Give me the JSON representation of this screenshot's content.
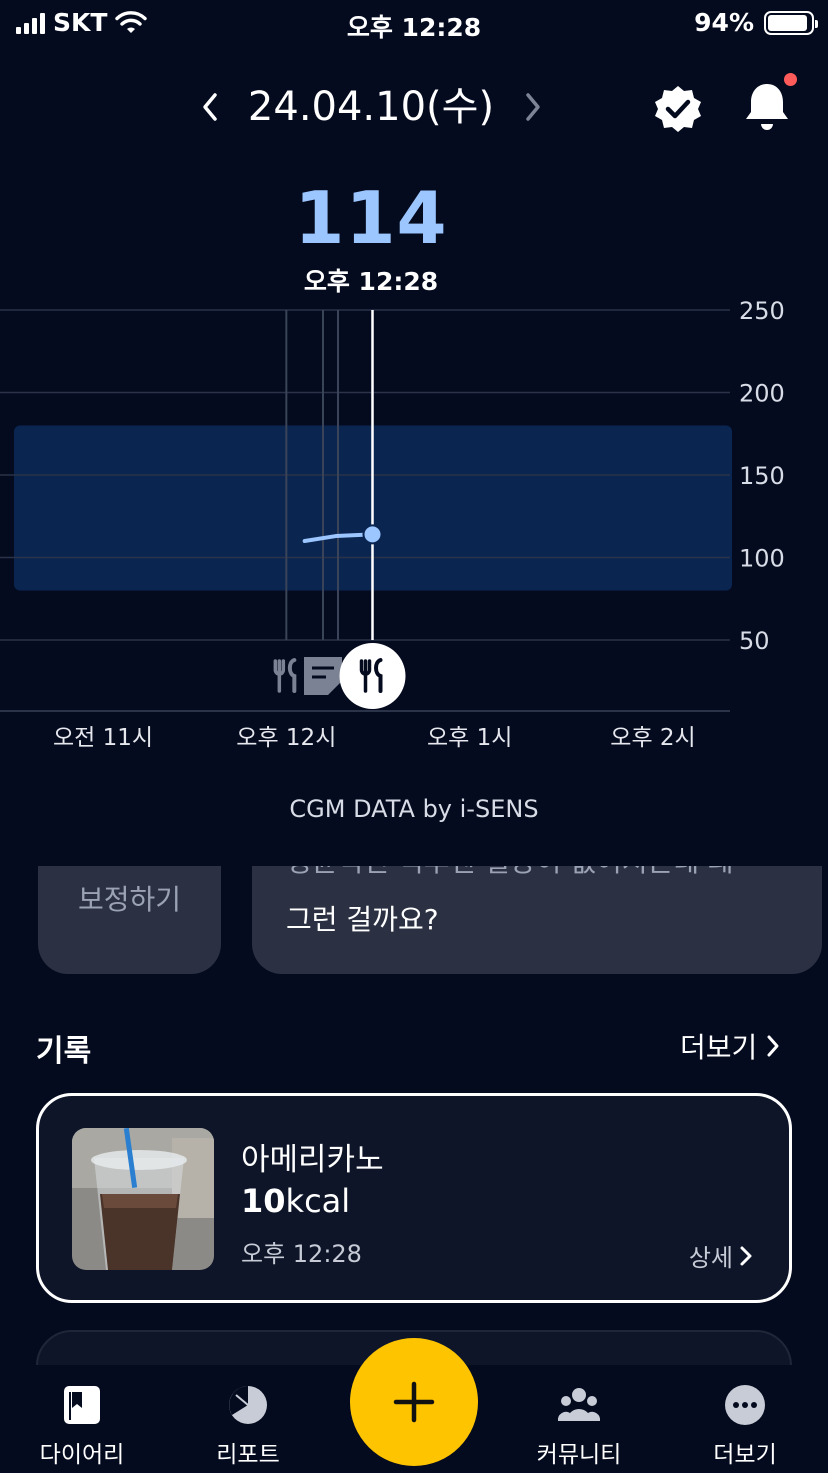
{
  "status_bar": {
    "carrier": "SKT",
    "time": "오후 12:28",
    "battery": "94%",
    "battery_level": 0.94
  },
  "header": {
    "date": "24.04.10(수)"
  },
  "glucose": {
    "value": "114",
    "time": "오후 12:28"
  },
  "chart_data": {
    "type": "line",
    "title": "",
    "y_ticks": [
      "250",
      "200",
      "150",
      "100",
      "50"
    ],
    "ylim": [
      50,
      250
    ],
    "target_range": [
      80,
      180
    ],
    "x_ticks": [
      "오전 11시",
      "오후 12시",
      "오후 1시",
      "오후 2시"
    ],
    "series": [
      {
        "values": [
          [
            12.1,
            110
          ],
          [
            12.27,
            113
          ],
          [
            12.47,
            114
          ]
        ]
      }
    ],
    "event_markers": [
      {
        "icon": "meal-icon",
        "time": 12.0
      },
      {
        "icon": "note-icon",
        "time": 12.2
      },
      {
        "icon": "meal-icon",
        "time": 12.47,
        "selected": true
      }
    ],
    "credit": "CGM DATA by i-SENS"
  },
  "cards": {
    "calibrate": "보정하기",
    "message_partial": "평균적인 식후엔 혈당이 없어지는데 왜",
    "message": "그런 걸까요?"
  },
  "records": {
    "title": "기록",
    "more": "더보기",
    "items": [
      {
        "name": "아메리카노",
        "kcal_value": "10",
        "kcal_unit": "kcal",
        "time": "오후 12:28",
        "detail": "상세"
      }
    ]
  },
  "nav": {
    "items": [
      {
        "label": "다이어리",
        "icon": "diary-icon"
      },
      {
        "label": "리포트",
        "icon": "report-icon"
      },
      {
        "label": "커뮤니티",
        "icon": "community-icon"
      },
      {
        "label": "더보기",
        "icon": "more-icon"
      }
    ],
    "fab_icon": "plus-icon"
  },
  "colors": {
    "background": "#050b1f",
    "accent": "#9cc6ff",
    "fab": "#ffc400",
    "range_band": "#0a2550",
    "alert_dot": "#ff5b5b"
  }
}
